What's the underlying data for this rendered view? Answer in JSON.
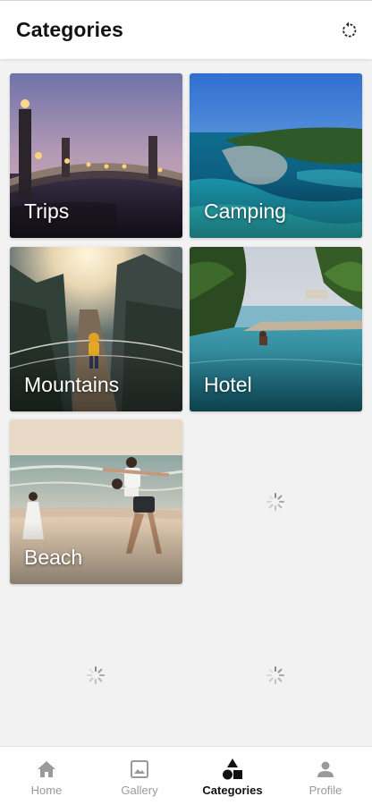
{
  "header": {
    "title": "Categories",
    "refresh_icon": "refresh-icon"
  },
  "categories": [
    {
      "label": "Trips"
    },
    {
      "label": "Camping"
    },
    {
      "label": "Mountains"
    },
    {
      "label": "Hotel"
    },
    {
      "label": "Beach"
    }
  ],
  "loading_placeholders": 3,
  "bottom_nav": {
    "items": [
      {
        "label": "Home",
        "icon": "home-icon",
        "active": false
      },
      {
        "label": "Gallery",
        "icon": "image-icon",
        "active": false
      },
      {
        "label": "Categories",
        "icon": "shapes-icon",
        "active": true
      },
      {
        "label": "Profile",
        "icon": "person-icon",
        "active": false
      }
    ]
  },
  "colors": {
    "background": "#f2f2f2",
    "active_text": "#111111",
    "inactive_text": "#9a9a9a"
  }
}
